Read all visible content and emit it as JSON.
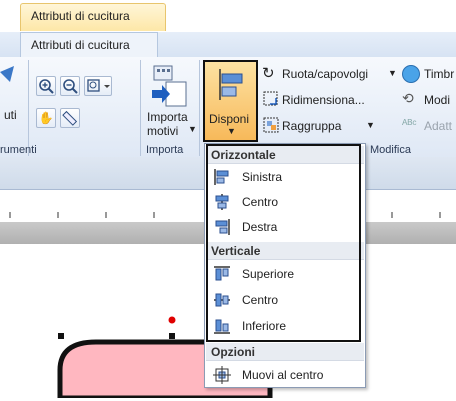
{
  "context_tab": {
    "label": "Attributi di cucitura"
  },
  "ribbon_tab": {
    "label": "Attributi di cucitura"
  },
  "ribbon": {
    "left_partial_label": "uti",
    "strumenti_label": "rumenti",
    "importa_btn": {
      "line1": "Importa",
      "line2": "motivi"
    },
    "importa_group": "Importa",
    "disponi_btn": {
      "label": "Disponi"
    },
    "ruota": "Ruota/capovolgi",
    "ridimensiona": "Ridimensiona...",
    "raggruppa": "Raggruppa",
    "timbro": "Timbr",
    "modi": "Modi",
    "adatt": "Adatt",
    "modifica_group": "Modifica"
  },
  "menu": {
    "header_orizzontale": "Orizzontale",
    "items_h": [
      "Sinistra",
      "Centro",
      "Destra"
    ],
    "header_verticale": "Verticale",
    "items_v": [
      "Superiore",
      "Centro",
      "Inferiore"
    ],
    "header_opzioni": "Opzioni",
    "item_opzioni": "Muovi al centro"
  },
  "colors": {
    "shape_fill": "#ffb7c0",
    "handle_red": "#e00000"
  }
}
